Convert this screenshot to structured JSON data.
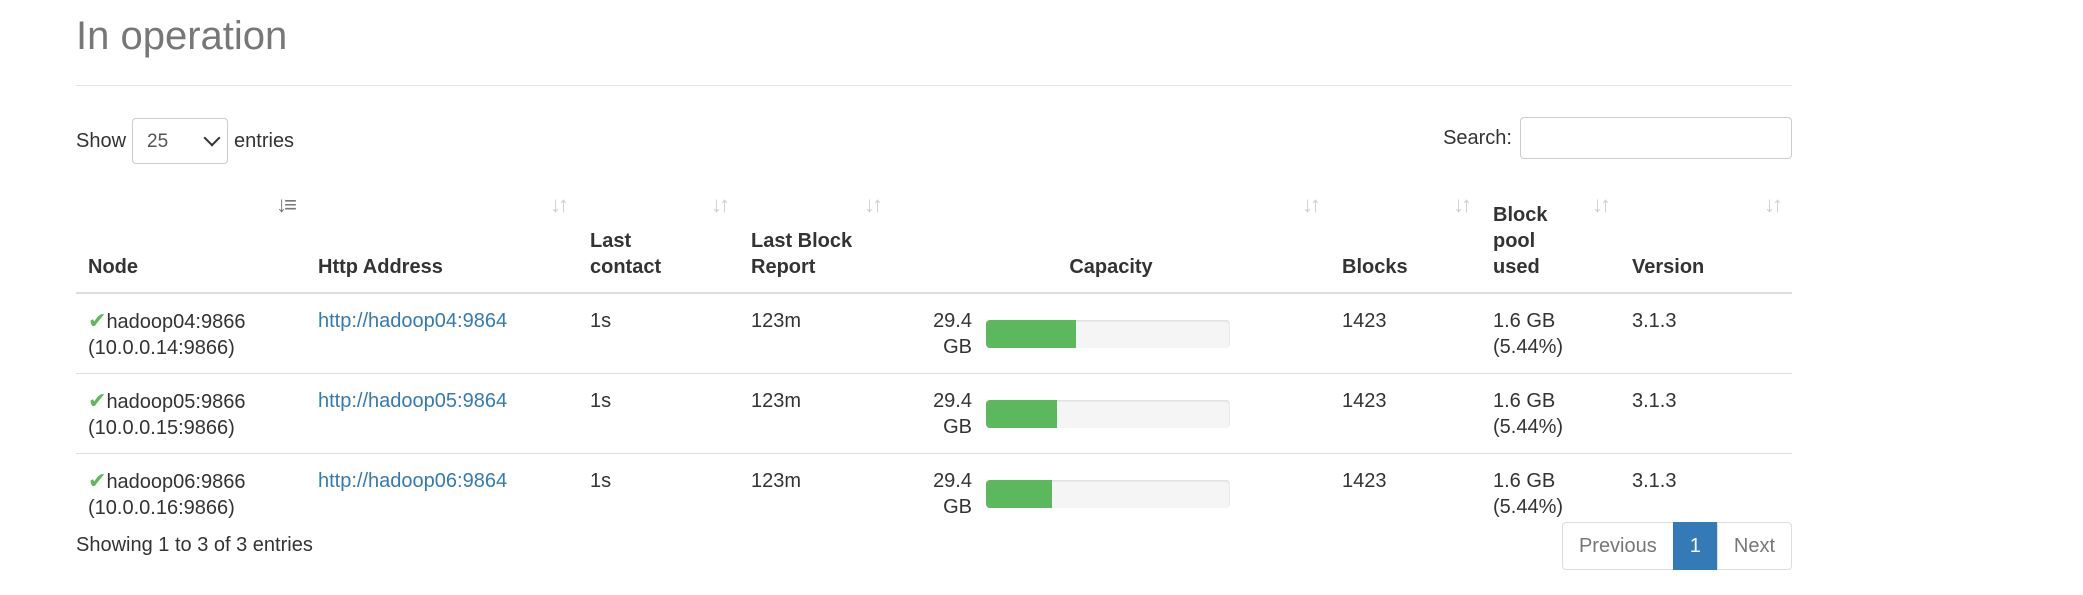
{
  "section": {
    "title": "In operation"
  },
  "length_menu": {
    "show_label": "Show",
    "selected": "25",
    "entries_label": "entries"
  },
  "search": {
    "label": "Search:",
    "value": ""
  },
  "columns": [
    {
      "label": "Node",
      "sort": "active"
    },
    {
      "label": "Http Address"
    },
    {
      "label": "Last contact"
    },
    {
      "label": "Last Block Report"
    },
    {
      "label": "Capacity"
    },
    {
      "label": "Blocks"
    },
    {
      "label": "Block pool used"
    },
    {
      "label": "Version"
    }
  ],
  "rows": [
    {
      "node": "hadoop04:9866",
      "node_ip": "(10.0.0.14:9866)",
      "http": "http://hadoop04:9864",
      "last_contact": "1s",
      "last_block_report": "123m",
      "capacity": "29.4 GB",
      "capacity_used_fraction": 0.37,
      "blocks": "1423",
      "pool_used": "1.6 GB",
      "pool_pct": "(5.44%)",
      "version": "3.1.3"
    },
    {
      "node": "hadoop05:9866",
      "node_ip": "(10.0.0.15:9866)",
      "http": "http://hadoop05:9864",
      "last_contact": "1s",
      "last_block_report": "123m",
      "capacity": "29.4 GB",
      "capacity_used_fraction": 0.29,
      "blocks": "1423",
      "pool_used": "1.6 GB",
      "pool_pct": "(5.44%)",
      "version": "3.1.3"
    },
    {
      "node": "hadoop06:9866",
      "node_ip": "(10.0.0.16:9866)",
      "http": "http://hadoop06:9864",
      "last_contact": "1s",
      "last_block_report": "123m",
      "capacity": "29.4 GB",
      "capacity_used_fraction": 0.27,
      "blocks": "1423",
      "pool_used": "1.6 GB",
      "pool_pct": "(5.44%)",
      "version": "3.1.3"
    }
  ],
  "info": "Showing 1 to 3 of 3 entries",
  "pagination": {
    "previous": "Previous",
    "current": "1",
    "next": "Next"
  },
  "colors": {
    "success": "#5cb85c",
    "link": "#337ab7",
    "muted": "#777777"
  },
  "icons": {
    "row_status": "checkmark-icon",
    "sort": "sort-arrows-icon"
  }
}
